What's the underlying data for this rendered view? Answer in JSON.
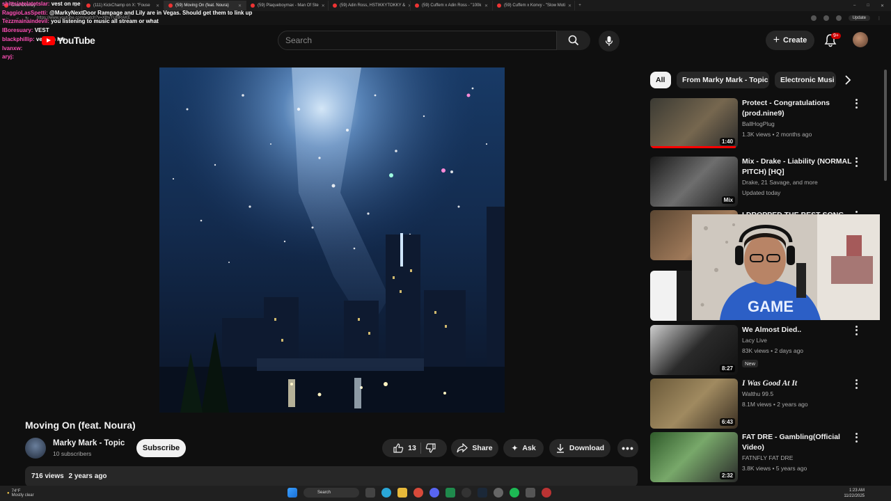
{
  "browser": {
    "tabs": [
      {
        "label": "Chat Overlay"
      },
      {
        "label": "(111) KickChamp on X: \"Fouse"
      },
      {
        "label": "(59) Moving On (feat. Noura)",
        "active": true
      },
      {
        "label": "(59) Plaqueboymax - Man Of Ste"
      },
      {
        "label": "(59) Adin Ross, HSTIKKYTOKKY &"
      },
      {
        "label": "(59) Cuffem x Adin Ross - \"100k"
      },
      {
        "label": "(59) Cuffem x Konvy - \"Slow Moti"
      }
    ],
    "url": "https://www.youtube.com/watch?v=XlhvTUNRAKE",
    "update_label": "Update"
  },
  "chat": [
    {
      "user": "shittsiatelatetslar:",
      "text": "vest on me"
    },
    {
      "user": "RaggioLasSpetti:",
      "text": "@MarkyNextDoor Rampage and Lily are in Vegas. Should get them to link up"
    },
    {
      "user": "Tezzmainaindevil:",
      "text": "you listening to music all stream or what"
    },
    {
      "user": "IBoresuary:",
      "text": "VEST"
    },
    {
      "user": "blackphillip:",
      "text": "vest on me"
    },
    {
      "user": "lvanxw:",
      "text": ""
    },
    {
      "user": "aryj:",
      "text": ""
    }
  ],
  "header": {
    "logo_text": "YouTube",
    "search_placeholder": "Search",
    "create_label": "Create",
    "notification_count": "9+"
  },
  "video": {
    "title": "Moving On (feat. Noura)",
    "channel": "Marky Mark - Topic",
    "subscribers": "10 subscribers",
    "subscribe_label": "Subscribe",
    "likes": "13",
    "share_label": "Share",
    "ask_label": "Ask",
    "download_label": "Download",
    "views": "716 views",
    "age": "2 years ago"
  },
  "chips": [
    "All",
    "From Marky Mark - Topic",
    "Electronic Musi"
  ],
  "recommendations": [
    {
      "title": "Protect - Congratulations (prod.nine9)",
      "channel": "BallHogPlug",
      "meta": "1.3K views • 2 months ago",
      "duration": "1:40",
      "watched": 0.98,
      "theme": "a"
    },
    {
      "title": "Mix - Drake - Liability (NORMAL PITCH) [HQ]",
      "channel": "Drake, 21 Savage, and more",
      "meta": "Updated today",
      "duration": "Mix",
      "theme": "b"
    },
    {
      "title": "I DROPPED THE BEST SONG",
      "channel": "",
      "meta": "",
      "duration": "",
      "theme": "c"
    },
    {
      "title": "",
      "channel": "",
      "meta": "",
      "duration": "",
      "theme": "d"
    },
    {
      "title": "We Almost Died..",
      "channel": "Lacy Live",
      "meta": "83K views • 2 days ago",
      "duration": "8:27",
      "badge": "New",
      "theme": "e"
    },
    {
      "title": "I Was Good At It",
      "channel": "Walthu 99.5",
      "meta": "8.1M views • 2 years ago",
      "duration": "6:43",
      "theme": "f"
    },
    {
      "title": "FAT DRE - Gambling(Official Video)",
      "channel": "FATNFLY FAT DRE",
      "meta": "3.8K views • 5 years ago",
      "duration": "2:32",
      "theme": "g"
    }
  ],
  "taskbar": {
    "weather_temp": "74°F",
    "weather_desc": "Mostly clear",
    "search_label": "Search",
    "time": "1:23 AM",
    "date": "11/22/2025"
  }
}
